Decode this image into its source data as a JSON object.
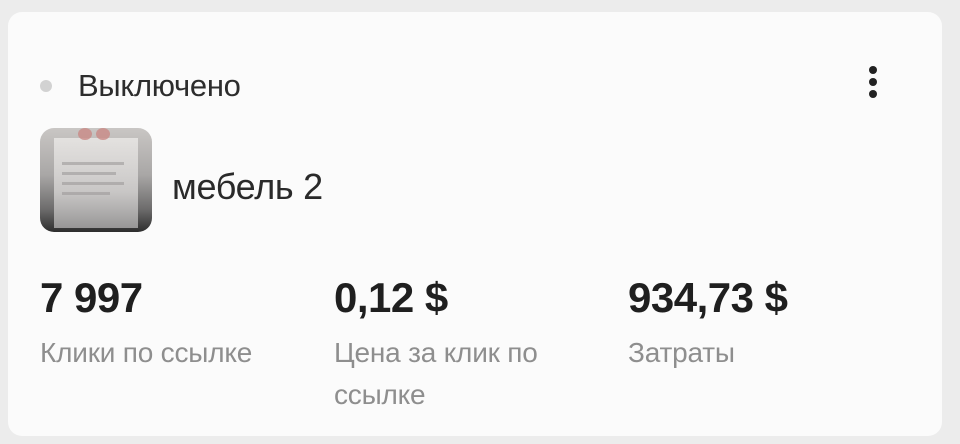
{
  "status": {
    "label": "Выключено",
    "dot_color": "#d2d2d2"
  },
  "menu": {
    "icon": "more-vertical-icon"
  },
  "campaign": {
    "name": "мебель 2",
    "thumbnail": "ad-thumbnail-image"
  },
  "metrics": [
    {
      "value": "7 997",
      "label": "Клики по ссылке"
    },
    {
      "value": "0,12 $",
      "label": "Цена за клик по ссылке"
    },
    {
      "value": "934,73 $",
      "label": "Затраты"
    }
  ]
}
